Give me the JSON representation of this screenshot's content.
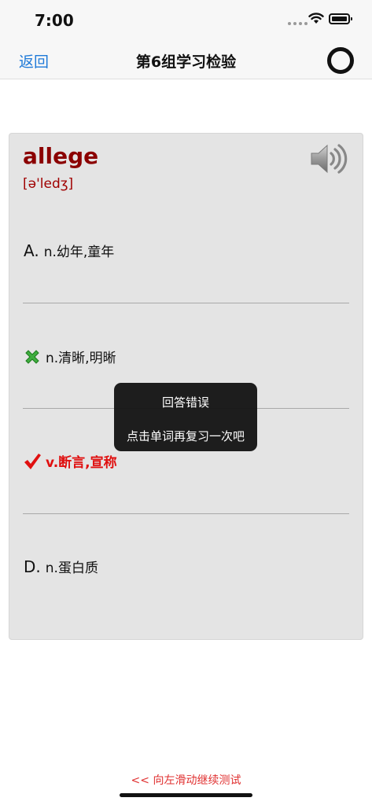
{
  "status_bar": {
    "time": "7:00"
  },
  "nav": {
    "back_label": "返回",
    "title": "第6组学习检验"
  },
  "card": {
    "word": "allege",
    "phonetic": "[ə'ledʒ]",
    "options": [
      {
        "letter": "A.",
        "text": "n.幼年,童年",
        "state": "normal"
      },
      {
        "letter": "",
        "text": "n.清晰,明晰",
        "state": "wrong",
        "icon": "cross-icon"
      },
      {
        "letter": "",
        "text": "v.断言,宣称",
        "state": "correct",
        "icon": "check-icon"
      },
      {
        "letter": "D.",
        "text": "n.蛋白质",
        "state": "normal"
      }
    ]
  },
  "toast": {
    "title": "回答错误",
    "message": "点击单词再复习一次吧"
  },
  "footer": {
    "swipe_hint": "<< 向左滑动继续测试"
  },
  "colors": {
    "word": "#8b0000",
    "link": "#1f7ad8",
    "correct": "#e01010",
    "wrong": "#2e9e2e",
    "card_bg": "#e4e4e4"
  }
}
